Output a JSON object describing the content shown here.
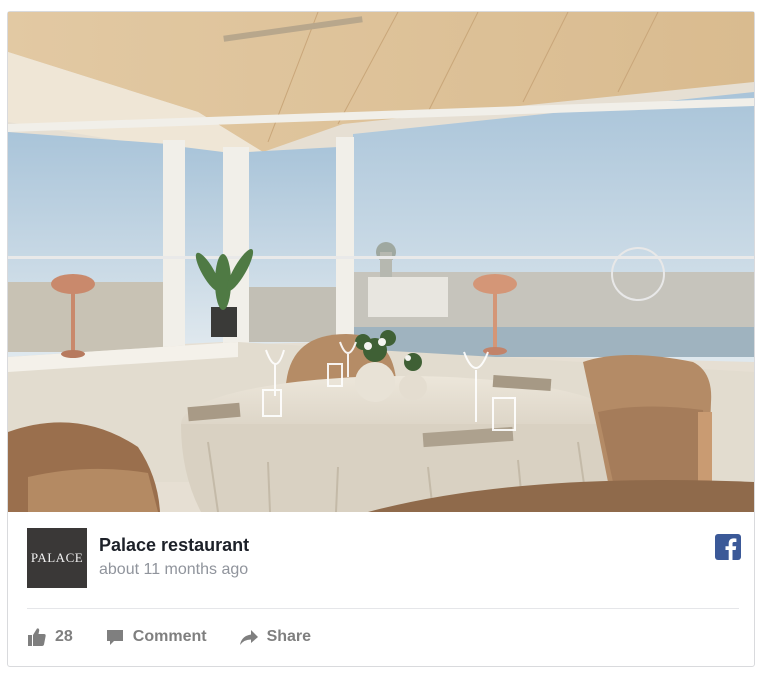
{
  "post": {
    "photo_alt": "",
    "page_name": "Palace restaurant",
    "timestamp": "about 11 months ago",
    "avatar_text": "PALACE"
  },
  "icons": {
    "brand": "facebook-icon",
    "like": "thumbs-up-icon",
    "comment": "speech-bubble-icon",
    "share": "share-arrow-icon"
  },
  "actions": {
    "like_count": "28",
    "comment_label": "Comment",
    "share_label": "Share"
  },
  "colors": {
    "facebook_blue": "#3b5998",
    "action_gray": "#7f7f7f",
    "meta_gray": "#90949c",
    "title_text": "#1d2129"
  }
}
